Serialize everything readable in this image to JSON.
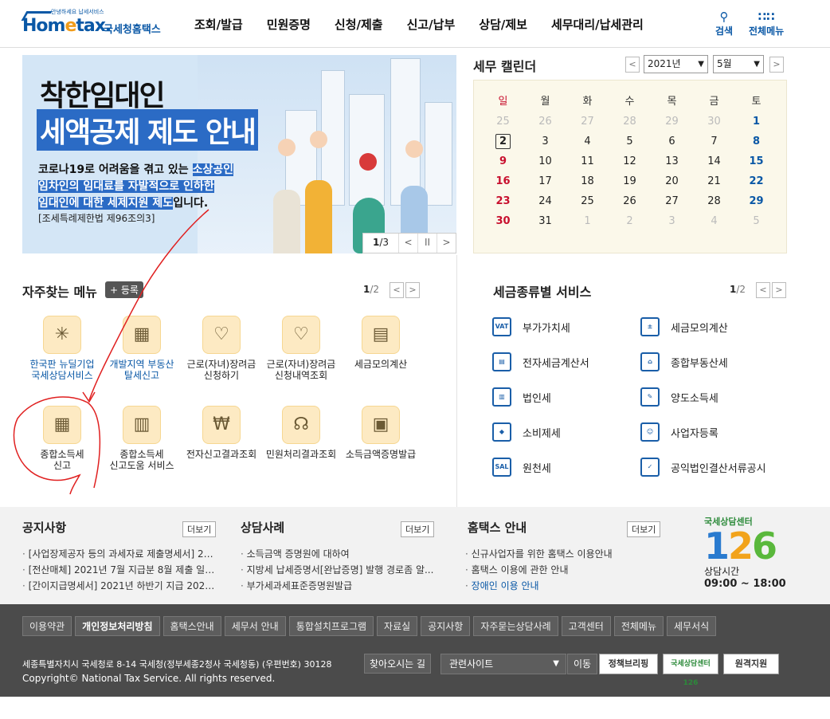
{
  "header": {
    "logo_sub": "안녕하세요 납세서비스",
    "logo_main_a": "Hom",
    "logo_main_e": "e",
    "logo_main_b": "tax.",
    "logo_kr": "국세청홈택스",
    "nav": [
      "조회/발급",
      "민원증명",
      "신청/제출",
      "신고/납부",
      "상담/제보",
      "세무대리/납세관리"
    ],
    "search_label": "검색",
    "allmenu_label": "전체메뉴"
  },
  "banner": {
    "title1": "착한임대인",
    "title2": "세액공제 제도 안내",
    "desc_line1_a": "코로나19로 어려움을 겪고 있는 ",
    "desc_line1_b": "소상공인",
    "desc_line2": "임차인의 임대료를 자발적으로 인하한",
    "desc_line3_a": "임대인에 대한 세제지원 제도",
    "desc_line3_b": "입니다.",
    "law": "[조세특례제한법 제96조의3]",
    "page_current": "1",
    "page_total": "/3"
  },
  "calendar": {
    "title": "세무 캘린더",
    "year": "2021년",
    "month": "5월",
    "weekdays": [
      "일",
      "월",
      "화",
      "수",
      "목",
      "금",
      "토"
    ],
    "weeks": [
      [
        "25",
        "26",
        "27",
        "28",
        "29",
        "30",
        "1"
      ],
      [
        "2",
        "3",
        "4",
        "5",
        "6",
        "7",
        "8"
      ],
      [
        "9",
        "10",
        "11",
        "12",
        "13",
        "14",
        "15"
      ],
      [
        "16",
        "17",
        "18",
        "19",
        "20",
        "21",
        "22"
      ],
      [
        "23",
        "24",
        "25",
        "26",
        "27",
        "28",
        "29"
      ],
      [
        "30",
        "31",
        "1",
        "2",
        "3",
        "4",
        "5"
      ]
    ]
  },
  "favorites": {
    "title": "자주찾는 메뉴",
    "register": "+ 등록",
    "page_current": "1",
    "page_total": "/2",
    "items": [
      {
        "label1": "한국판 뉴딜기업",
        "label2": "국세상담서비스",
        "icon": "sparkle-icon"
      },
      {
        "label1": "개발지역 부동산",
        "label2": "탈세신고",
        "icon": "building-won-icon"
      },
      {
        "label1": "근로(자녀)장려금",
        "label2": "신청하기",
        "icon": "heart-pen-icon"
      },
      {
        "label1": "근로(자녀)장려금",
        "label2": "신청내역조회",
        "icon": "heart-search-icon"
      },
      {
        "label1": "세금모의계산",
        "label2": "",
        "icon": "calc-pen-icon"
      },
      {
        "label1": "종합소득세",
        "label2": "신고",
        "icon": "calendar-pen-icon"
      },
      {
        "label1": "종합소득세",
        "label2": "신고도움 서비스",
        "icon": "doc-search-icon"
      },
      {
        "label1": "전자신고결과조회",
        "label2": "",
        "icon": "won-search-icon"
      },
      {
        "label1": "민원처리결과조회",
        "label2": "",
        "icon": "headset-icon"
      },
      {
        "label1": "소득금액증명발급",
        "label2": "",
        "icon": "printer-icon"
      }
    ]
  },
  "tax_services": {
    "title": "세금종류별 서비스",
    "page_current": "1",
    "page_total": "/2",
    "items": [
      {
        "label": "부가가치세",
        "icon": "vat-icon",
        "abbr": "VAT"
      },
      {
        "label": "세금모의계산",
        "icon": "calculator-icon",
        "abbr": "±"
      },
      {
        "label": "전자세금계산서",
        "icon": "invoice-icon",
        "abbr": "▤"
      },
      {
        "label": "종합부동산세",
        "icon": "real-estate-icon",
        "abbr": "⌂"
      },
      {
        "label": "법인세",
        "icon": "corporate-icon",
        "abbr": "▥"
      },
      {
        "label": "양도소득세",
        "icon": "transfer-icon",
        "abbr": "✎"
      },
      {
        "label": "소비제세",
        "icon": "diamond-icon",
        "abbr": "◆"
      },
      {
        "label": "사업자등록",
        "icon": "person-icon",
        "abbr": "☺"
      },
      {
        "label": "원천세",
        "icon": "salary-icon",
        "abbr": "SAL"
      },
      {
        "label": "공익법인결산서류공시",
        "icon": "clipboard-icon",
        "abbr": "✓"
      }
    ]
  },
  "notices": {
    "notice_title": "공지사항",
    "consult_title": "상담사례",
    "guide_title": "홈택스 안내",
    "more": "더보기",
    "notice_items": [
      "[사업장제공자 등의 과세자료 제출명세서] 20...",
      "[전산매체] 2021년 7월 지급분 8월 제출 일용...",
      "[간이지급명세서] 2021년 하반기 지급 2022년..."
    ],
    "consult_items": [
      "소득금액 증명원에 대하여",
      "지방세 납세증명서[완납증명] 발행 경로좀 알...",
      "부가세과세표준증명원발급"
    ],
    "guide_items": [
      "신규사업자를 위한 홈택스 이용안내",
      "홈택스 이용에 관한 안내",
      "장애인 이용 안내"
    ],
    "center_top": "국세상담센터",
    "center_num_a": "1",
    "center_num_b": "2",
    "center_num_c": "6",
    "center_hours_label": "상담시간",
    "center_hours": "09:00 ~ 18:00"
  },
  "footer": {
    "links": [
      "이용약관",
      "개인정보처리방침",
      "홈택스안내",
      "세무서 안내",
      "통합설치프로그램",
      "자료실",
      "공지사항",
      "자주묻는상담사례",
      "고객센터",
      "전체메뉴",
      "세무서식"
    ],
    "address": "세종특별자치시 국세청로 8-14 국세청(정부세종2청사 국세청동) (우편번호) 30128",
    "find_way": "찾아오시는 길",
    "copyright": "Copyright© National Tax Service. All rights reserved.",
    "related": "관련사이트",
    "go": "이동",
    "banner1": "정책브리핑",
    "banner2": "국세상담센터 126",
    "banner3": "원격지원"
  }
}
